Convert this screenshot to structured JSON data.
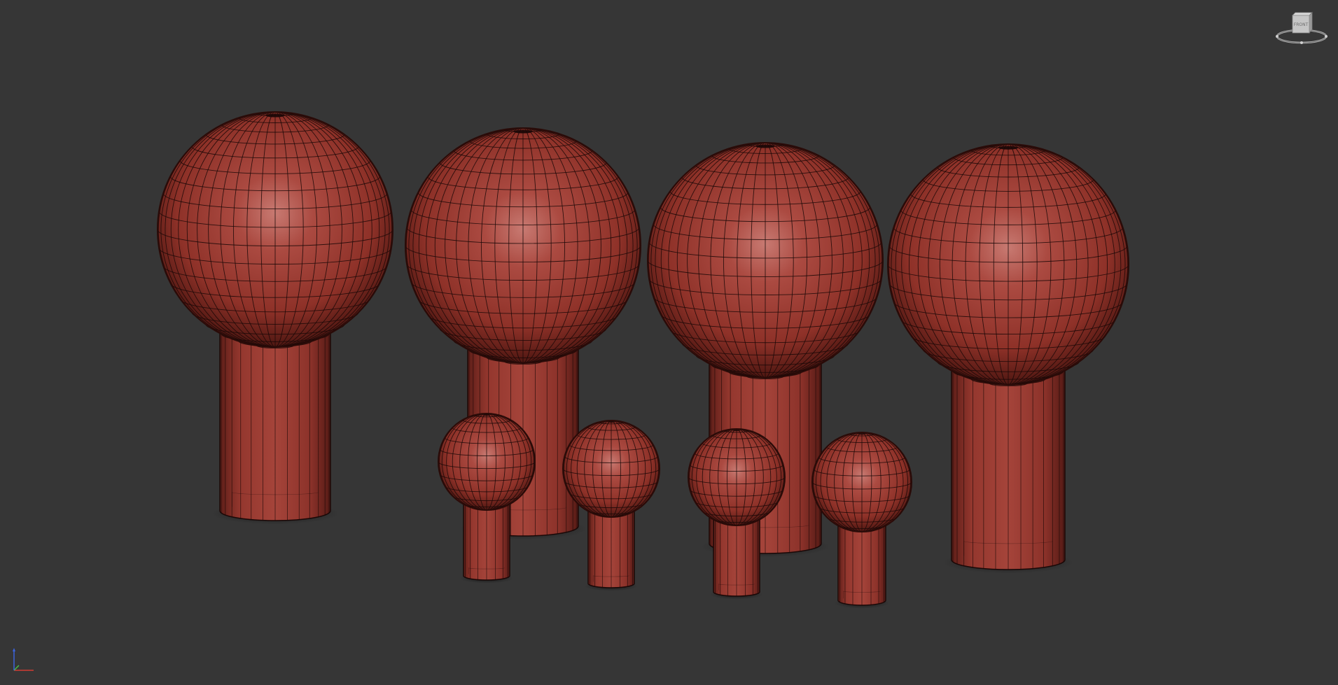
{
  "viewport": {
    "background_color": "#363636",
    "mesh_color": "#a03a32",
    "wire_color": "#1a0807",
    "objects": [
      {
        "name": "large-sphere-stem-1",
        "size": "large"
      },
      {
        "name": "large-sphere-stem-2",
        "size": "large"
      },
      {
        "name": "large-sphere-stem-3",
        "size": "large"
      },
      {
        "name": "large-sphere-stem-4",
        "size": "large"
      },
      {
        "name": "small-sphere-stem-1",
        "size": "small"
      },
      {
        "name": "small-sphere-stem-2",
        "size": "small"
      },
      {
        "name": "small-sphere-stem-3",
        "size": "small"
      },
      {
        "name": "small-sphere-stem-4",
        "size": "small"
      }
    ]
  },
  "viewcube": {
    "face_label": "FRONT",
    "icon": "viewcube-icon"
  },
  "axis_tripod": {
    "icon": "axis-tripod-icon",
    "x_color": "#d23c32",
    "y_color": "#46be46",
    "z_color": "#3c64dc"
  }
}
